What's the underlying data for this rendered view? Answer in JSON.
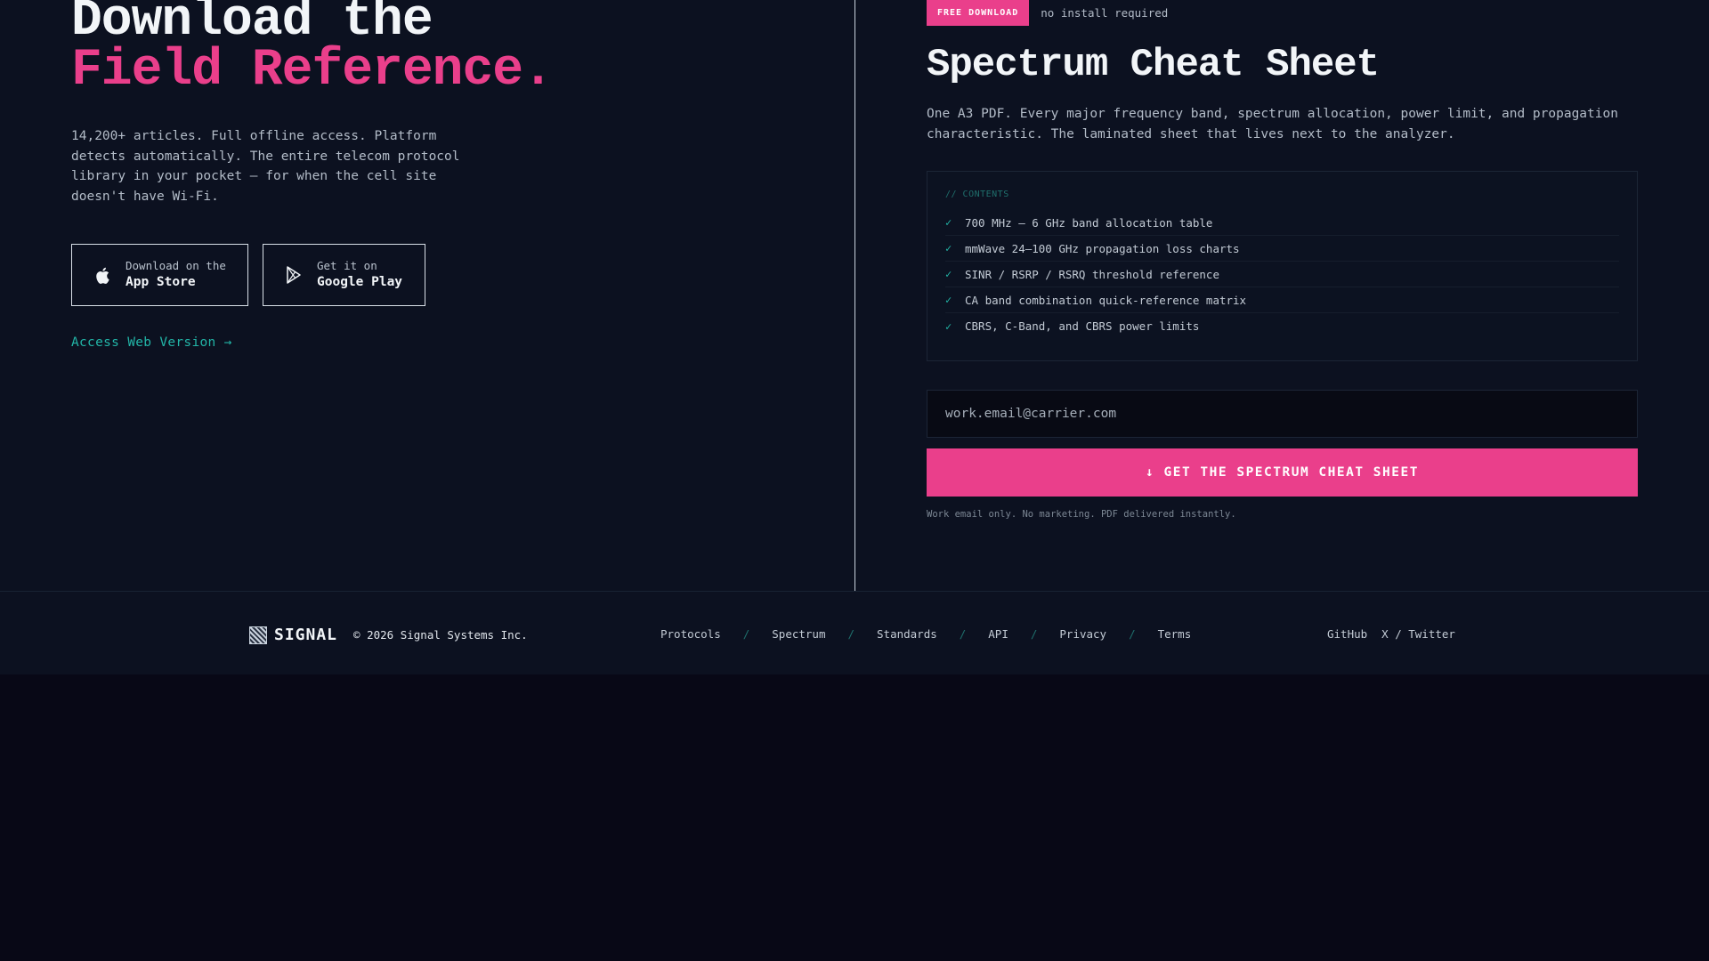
{
  "hero": {
    "headline_line1": "Download the",
    "headline_line2": "Field Reference.",
    "lede": "14,200+ articles. Full offline access. Platform detects automatically. The entire telecom protocol library in your pocket — for when the cell site doesn't have Wi-Fi.",
    "app_store": {
      "small": "Download on the",
      "big": "App Store",
      "icon": "apple-icon"
    },
    "google_play": {
      "small": "Get it on",
      "big": "Google Play",
      "icon": "play-icon"
    },
    "web_link": "Access Web Version →"
  },
  "cheat_sheet": {
    "badge": "FREE DOWNLOAD",
    "badge_note": "no install required",
    "title": "Spectrum Cheat Sheet",
    "description": "One A3 PDF. Every major frequency band, spectrum allocation, power limit, and propagation characteristic. The laminated sheet that lives next to the analyzer.",
    "contents_label": "// CONTENTS",
    "contents": [
      "700 MHz – 6 GHz band allocation table",
      "mmWave 24–100 GHz propagation loss charts",
      "SINR / RSRP / RSRQ threshold reference",
      "CA band combination quick-reference matrix",
      "CBRS, C-Band, and CBRS power limits"
    ],
    "check_glyph": "✓",
    "email_placeholder": "work.email@carrier.com",
    "cta_label": "↓ GET THE SPECTRUM CHEAT SHEET",
    "fine_print": "Work email only. No marketing. PDF delivered instantly."
  },
  "footer": {
    "brand": "SIGNAL",
    "copyright": "© 2026 Signal Systems Inc.",
    "nav": [
      "Protocols",
      "Spectrum",
      "Standards",
      "API",
      "Privacy",
      "Terms"
    ],
    "separator": "/",
    "social": [
      "GitHub",
      "X / Twitter"
    ]
  },
  "colors": {
    "accent_pink": "#ea3f8b",
    "accent_teal": "#22b5a7",
    "background": "#0c1120"
  }
}
